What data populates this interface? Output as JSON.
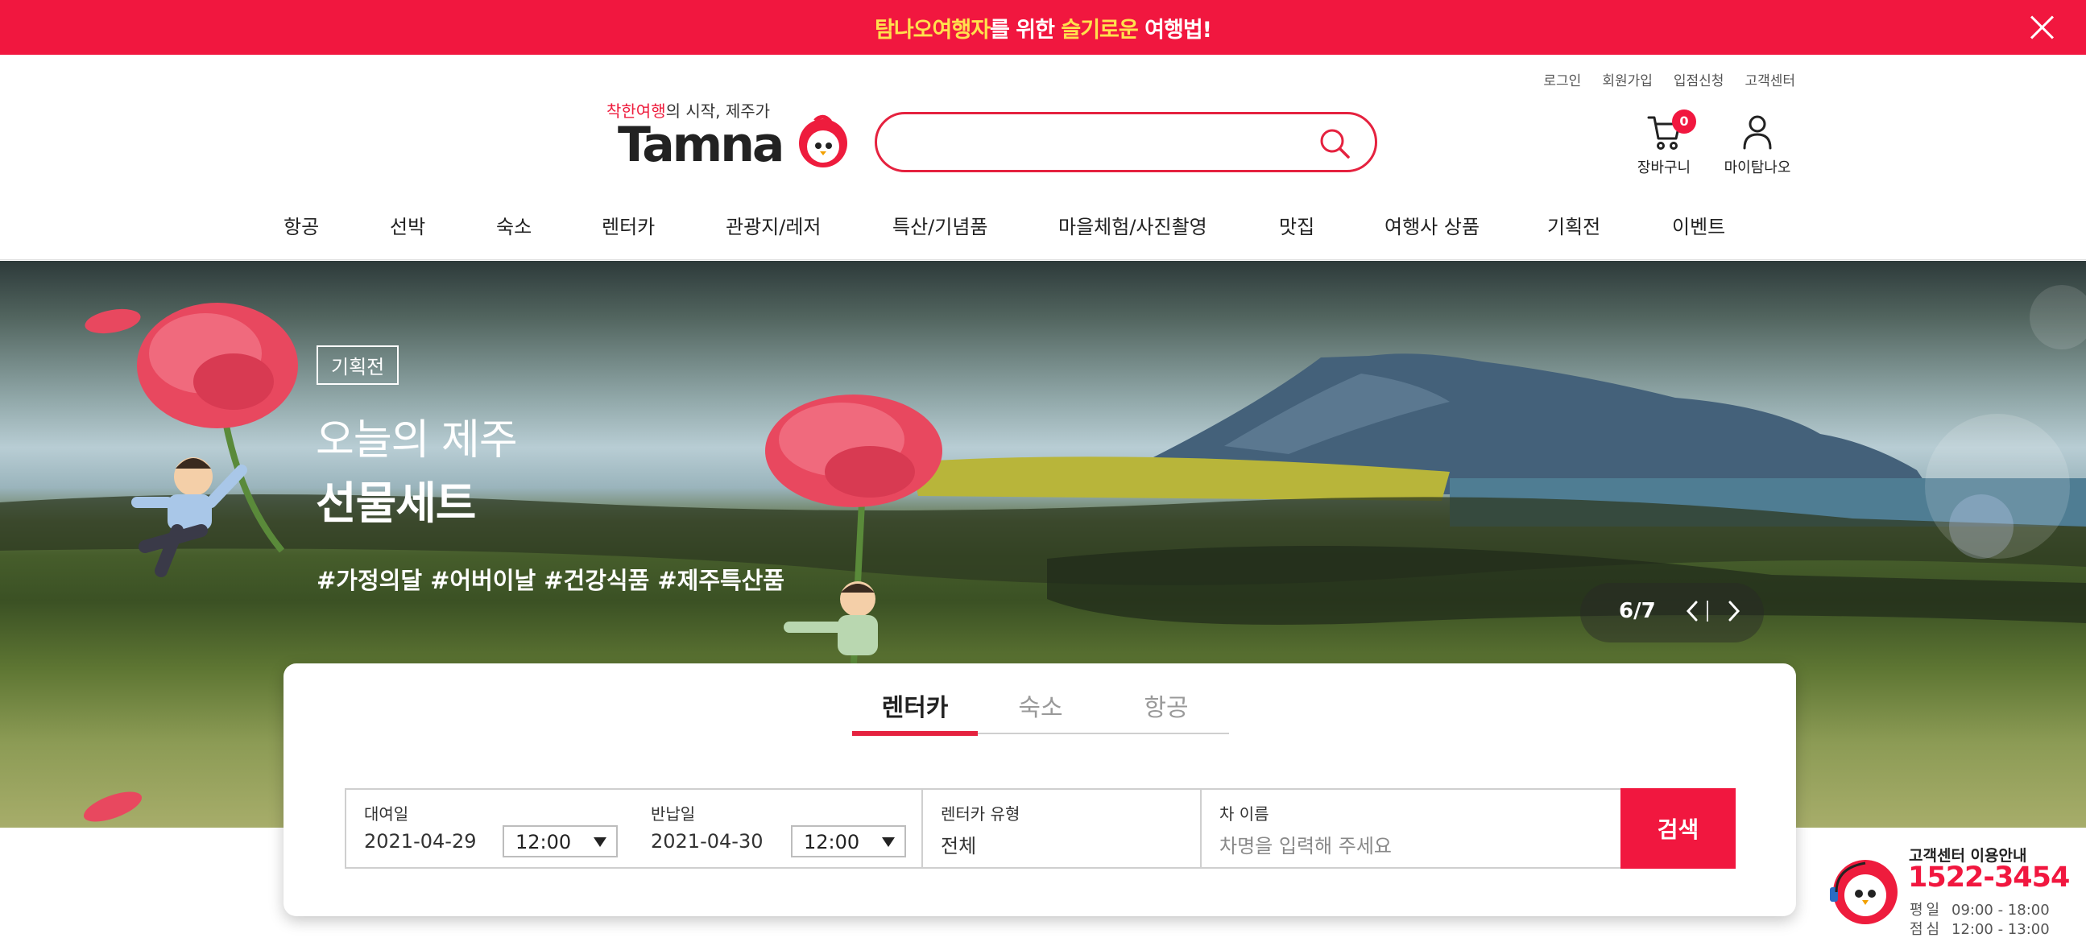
{
  "promo": {
    "part1": "탐나오여행자",
    "part2": "를 위한 ",
    "part3": "슬기로운",
    "part4": " 여행법!"
  },
  "util_links": [
    "로그인",
    "회원가입",
    "입점신청",
    "고객센터"
  ],
  "logo": {
    "tagline_red": "착한여행",
    "tagline_rest": "의 시작, 제주가",
    "wordmark": "Tamna"
  },
  "search": {
    "placeholder": "",
    "value": ""
  },
  "header_icons": {
    "cart_label": "장바구니",
    "cart_count": "0",
    "mypage_label": "마이탐나오"
  },
  "nav": [
    "항공",
    "선박",
    "숙소",
    "렌터카",
    "관광지/레저",
    "특산/기념품",
    "마을체험/사진촬영",
    "맛집",
    "여행사 상품",
    "기획전",
    "이벤트"
  ],
  "hero": {
    "badge": "기획전",
    "title1": "오늘의 제주",
    "title2": "선물세트",
    "tags": "#가정의달 #어버이날 #건강식품 #제주특산품",
    "pager": "6/7"
  },
  "booking": {
    "tabs": [
      "렌터카",
      "숙소",
      "항공"
    ],
    "active_tab": "렌터카",
    "pickup_label": "대여일",
    "pickup_date": "2021-04-29",
    "pickup_time": "12:00",
    "return_label": "반납일",
    "return_date": "2021-04-30",
    "return_time": "12:00",
    "type_label": "렌터카 유형",
    "type_value": "전체",
    "car_label": "차 이름",
    "car_placeholder": "차명을 입력해 주세요",
    "search_button": "검색"
  },
  "customer_center": {
    "title": "고객센터 이용안내",
    "phone": "1522-3454",
    "weekday_label": "평일",
    "weekday_hours": "09:00 - 18:00",
    "lunch_label": "점심",
    "lunch_hours": "12:00 - 13:00"
  },
  "colors": {
    "brand_red": "#f1173f",
    "promo_highlight": "#ffe14d"
  }
}
